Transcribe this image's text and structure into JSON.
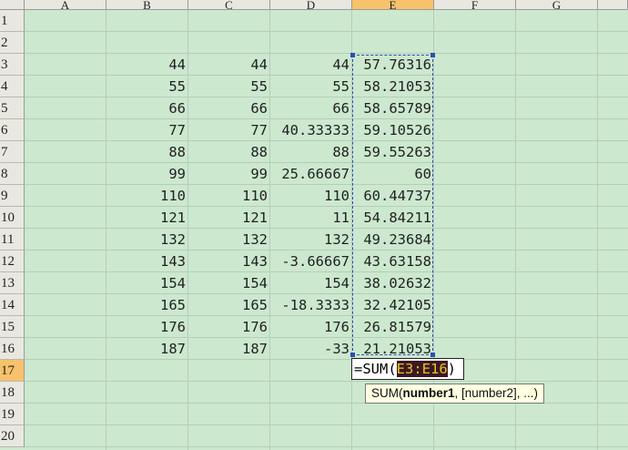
{
  "columns": [
    "A",
    "B",
    "C",
    "D",
    "E",
    "F",
    "G"
  ],
  "selected_column": "E",
  "rows": [
    "1",
    "2",
    "3",
    "4",
    "5",
    "6",
    "7",
    "8",
    "9",
    "10",
    "11",
    "12",
    "13",
    "14",
    "15",
    "16",
    "17",
    "18",
    "19",
    "20"
  ],
  "selected_row": "17",
  "table": [
    {
      "row": "3",
      "B": "44",
      "C": "44",
      "D": "44",
      "E": "57.76316"
    },
    {
      "row": "4",
      "B": "55",
      "C": "55",
      "D": "55",
      "E": "58.21053"
    },
    {
      "row": "5",
      "B": "66",
      "C": "66",
      "D": "66",
      "E": "58.65789"
    },
    {
      "row": "6",
      "B": "77",
      "C": "77",
      "D": "40.33333",
      "E": "59.10526"
    },
    {
      "row": "7",
      "B": "88",
      "C": "88",
      "D": "88",
      "E": "59.55263"
    },
    {
      "row": "8",
      "B": "99",
      "C": "99",
      "D": "25.66667",
      "E": "60"
    },
    {
      "row": "9",
      "B": "110",
      "C": "110",
      "D": "110",
      "E": "60.44737"
    },
    {
      "row": "10",
      "B": "121",
      "C": "121",
      "D": "11",
      "E": "54.84211"
    },
    {
      "row": "11",
      "B": "132",
      "C": "132",
      "D": "132",
      "E": "49.23684"
    },
    {
      "row": "12",
      "B": "143",
      "C": "143",
      "D": "-3.66667",
      "E": "43.63158"
    },
    {
      "row": "13",
      "B": "154",
      "C": "154",
      "D": "154",
      "E": "38.02632"
    },
    {
      "row": "14",
      "B": "165",
      "C": "165",
      "D": "-18.3333",
      "E": "32.42105"
    },
    {
      "row": "15",
      "B": "176",
      "C": "176",
      "D": "176",
      "E": "26.81579"
    },
    {
      "row": "16",
      "B": "187",
      "C": "187",
      "D": "-33",
      "E": "21.21053"
    }
  ],
  "formula": {
    "prefix": "=SUM(",
    "range": "E3:E16",
    "suffix": ")"
  },
  "tooltip": {
    "func": "SUM(",
    "arg1": "number1",
    "rest": ", [number2], ...)"
  },
  "colors": {
    "grid_bg": "#cce8cf",
    "header_bg": "#e8e8e0",
    "header_selected": "#f7c26b",
    "marquee": "#2a4fb0",
    "range_highlight_bg": "#3a1a22",
    "range_highlight_fg": "#f0c020",
    "tooltip_bg": "#ffffe1"
  }
}
